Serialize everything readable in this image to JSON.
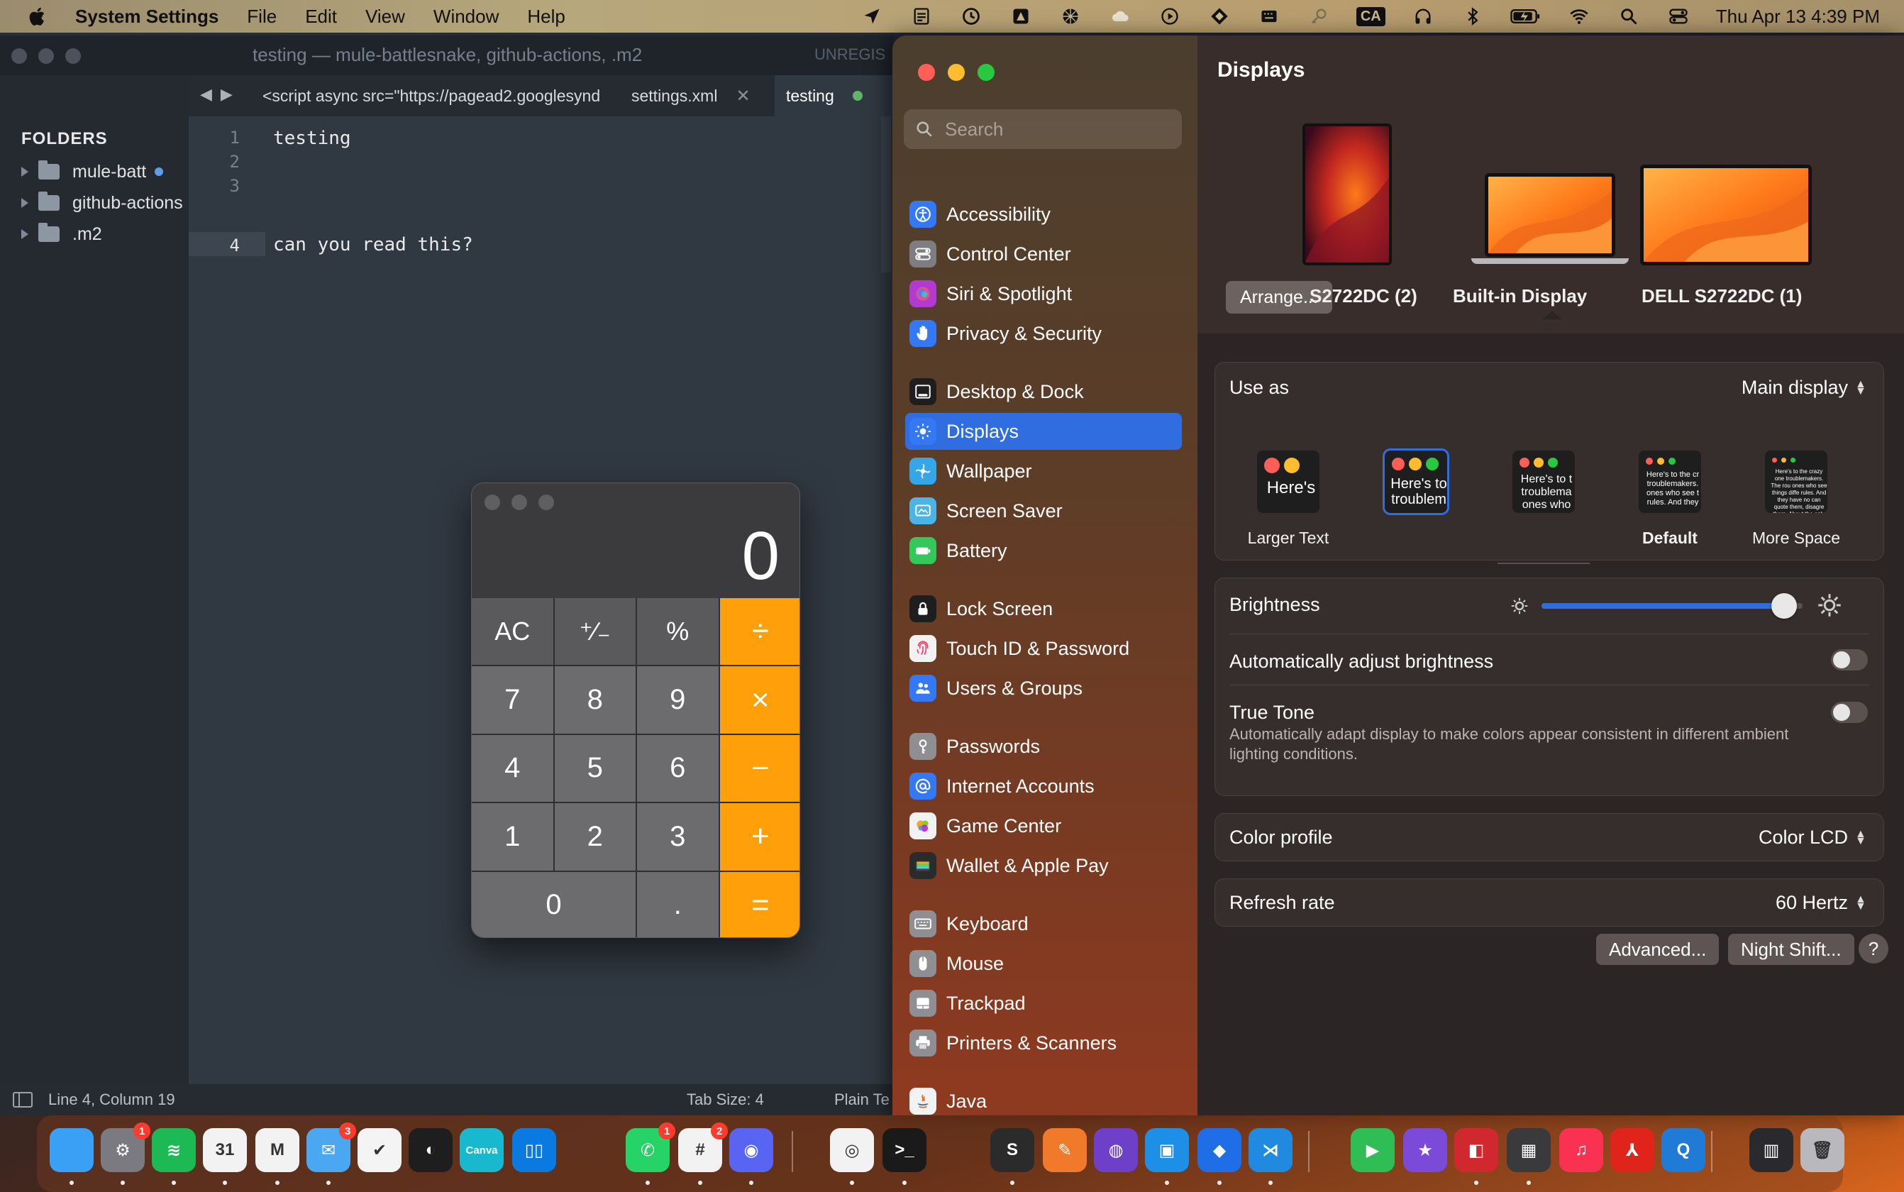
{
  "menubar": {
    "app_name": "System Settings",
    "menus": [
      "File",
      "Edit",
      "View",
      "Window",
      "Help"
    ],
    "input_source": "CA",
    "clock": "Thu Apr 13  4:39 PM"
  },
  "sublime": {
    "title": "testing — mule-battlesnake, github-actions, .m2",
    "unregistered": "UNREGIS",
    "sidebar_heading": "FOLDERS",
    "folders": [
      {
        "name": "mule-batt",
        "modified": true
      },
      {
        "name": "github-actions",
        "modified": false
      },
      {
        "name": ".m2",
        "modified": false
      }
    ],
    "tabs": [
      {
        "label": "<script async src=\"https://pagead2.googlesynd"
      },
      {
        "label": "settings.xml"
      },
      {
        "label": "testing"
      }
    ],
    "line_numbers": [
      "1",
      "2",
      "3",
      "4"
    ],
    "lines": [
      "testing",
      "",
      "",
      "can you read this?"
    ],
    "status": {
      "position": "Line 4, Column 19",
      "tab_size": "Tab Size: 4",
      "syntax": "Plain Te"
    }
  },
  "calculator": {
    "display": "0",
    "keys": [
      "AC",
      "⁺∕₋",
      "%",
      "÷",
      "7",
      "8",
      "9",
      "×",
      "4",
      "5",
      "6",
      "−",
      "1",
      "2",
      "3",
      "+",
      "0",
      ".",
      "="
    ]
  },
  "settings": {
    "search_placeholder": "Search",
    "sidebar": [
      {
        "label": "Accessibility",
        "icon": "accessibility-icon",
        "color": "#3478f6"
      },
      {
        "label": "Control Center",
        "icon": "control-center-icon",
        "color": "#7d7d82"
      },
      {
        "label": "Siri & Spotlight",
        "icon": "siri-icon",
        "color": "#b33ad1"
      },
      {
        "label": "Privacy & Security",
        "icon": "hand-icon",
        "color": "#3478f6"
      },
      {
        "label": "Desktop & Dock",
        "icon": "dock-icon",
        "color": "#1e1e1e"
      },
      {
        "label": "Displays",
        "icon": "sun-icon",
        "color": "#3478f6"
      },
      {
        "label": "Wallpaper",
        "icon": "wallpaper-icon",
        "color": "#35a6e8"
      },
      {
        "label": "Screen Saver",
        "icon": "screen-saver-icon",
        "color": "#4ab4e6"
      },
      {
        "label": "Battery",
        "icon": "battery-icon",
        "color": "#34c759"
      },
      {
        "label": "Lock Screen",
        "icon": "lock-icon",
        "color": "#1e1e1e"
      },
      {
        "label": "Touch ID & Password",
        "icon": "fingerprint-icon",
        "color": "#f2f2f2"
      },
      {
        "label": "Users & Groups",
        "icon": "users-icon",
        "color": "#3478f6"
      },
      {
        "label": "Passwords",
        "icon": "key-icon",
        "color": "#8e8e93"
      },
      {
        "label": "Internet Accounts",
        "icon": "at-icon",
        "color": "#3478f6"
      },
      {
        "label": "Game Center",
        "icon": "game-center-icon",
        "color": "#f2f2f2"
      },
      {
        "label": "Wallet & Apple Pay",
        "icon": "wallet-icon",
        "color": "#2b2b2b"
      },
      {
        "label": "Keyboard",
        "icon": "keyboard-icon",
        "color": "#8e8e93"
      },
      {
        "label": "Mouse",
        "icon": "mouse-icon",
        "color": "#8e8e93"
      },
      {
        "label": "Trackpad",
        "icon": "trackpad-icon",
        "color": "#8e8e93"
      },
      {
        "label": "Printers & Scanners",
        "icon": "printer-icon",
        "color": "#8e8e93"
      },
      {
        "label": "Java",
        "icon": "java-icon",
        "color": "#f2f2f2"
      }
    ],
    "page_title": "Displays",
    "arrange_button": "Arrange...",
    "displays": [
      {
        "name": "S2722DC (2)"
      },
      {
        "name": "Built-in Display",
        "selected": true
      },
      {
        "name": "DELL S2722DC (1)"
      }
    ],
    "use_as": {
      "label": "Use as",
      "value": "Main display"
    },
    "resolutions": [
      {
        "label": "Larger Text",
        "sample": "Here's"
      },
      {
        "label": "",
        "sample": "Here's to troublem",
        "selected": true
      },
      {
        "label": "",
        "sample": "Here's to t troublema ones who"
      },
      {
        "label": "Default",
        "sample": "Here's to the cr troublemakers. ones who see t rules. And they"
      },
      {
        "label": "More Space",
        "sample": "Here's to the crazy one troublemakers. The rou ones who see things diffe rules. And they have no can quote them, disagre them. About the only thi Because they change it"
      }
    ],
    "brightness": {
      "label": "Brightness",
      "level": 0.93
    },
    "auto_brightness": {
      "label": "Automatically adjust brightness",
      "on": false
    },
    "true_tone": {
      "label": "True Tone",
      "description": "Automatically adapt display to make colors appear consistent in different ambient lighting conditions.",
      "on": false
    },
    "color_profile": {
      "label": "Color profile",
      "value": "Color LCD"
    },
    "refresh_rate": {
      "label": "Refresh rate",
      "value": "60 Hertz"
    },
    "buttons": {
      "advanced": "Advanced...",
      "night_shift": "Night Shift...",
      "help": "?"
    }
  },
  "dock": {
    "apps": [
      {
        "name": "finder-icon",
        "label": "",
        "color": "#3aa0f5",
        "running": true
      },
      {
        "name": "system-settings-icon",
        "label": "⚙",
        "color": "#7a7a80",
        "badge": "1",
        "running": true
      },
      {
        "name": "spotify-icon",
        "label": "≋",
        "color": "#1db954",
        "running": true
      },
      {
        "name": "calendar-icon",
        "label": "31",
        "color": "#f2f2f2",
        "running": true
      },
      {
        "name": "gmail-icon",
        "label": "M",
        "color": "#f2f2f2",
        "running": true
      },
      {
        "name": "mail-icon",
        "label": "✉",
        "color": "#4aa7f0",
        "badge": "3",
        "running": true
      },
      {
        "name": "tasks-icon",
        "label": "✔",
        "color": "#f4f4f4",
        "running": false
      },
      {
        "name": "figma-icon",
        "label": "◐",
        "color": "#1e1e1e",
        "running": false
      },
      {
        "name": "canva-icon",
        "label": "Canva",
        "color": "#18b9cf",
        "running": false
      },
      {
        "name": "trello-icon",
        "label": "▯▯",
        "color": "#0a7ae0",
        "running": false
      },
      {
        "name": "whatsapp-icon",
        "label": "✆",
        "color": "#25d366",
        "badge": "1",
        "running": true
      },
      {
        "name": "slack-icon",
        "label": "#",
        "color": "#f2f2f2",
        "badge": "2",
        "running": true
      },
      {
        "name": "discord-icon",
        "label": "◉",
        "color": "#5865f2",
        "running": true
      },
      {
        "name": "chrome-icon",
        "label": "◎",
        "color": "#f2f2f2",
        "running": true
      },
      {
        "name": "terminal-icon",
        "label": ">_",
        "color": "#1a1a1a",
        "running": true
      },
      {
        "name": "sublime-icon",
        "label": "S",
        "color": "#2b2b2b",
        "running": true
      },
      {
        "name": "pen-icon",
        "label": "✎",
        "color": "#f07a2a",
        "running": false
      },
      {
        "name": "github-desktop-icon",
        "label": "◍",
        "color": "#6e40c9",
        "running": false
      },
      {
        "name": "docker-icon",
        "label": "▣",
        "color": "#1d8fe6",
        "running": true
      },
      {
        "name": "sourcetree-icon",
        "label": "◆",
        "color": "#1f6ee8",
        "running": true
      },
      {
        "name": "vscode-icon",
        "label": "⋊",
        "color": "#1f8ae0",
        "running": true
      },
      {
        "name": "facetime-icon",
        "label": "▶",
        "color": "#2fbe56",
        "running": false
      },
      {
        "name": "imovie-icon",
        "label": "★",
        "color": "#7b4ad8",
        "running": false
      },
      {
        "name": "photo-booth-icon",
        "label": "◧",
        "color": "#d1282f",
        "running": true
      },
      {
        "name": "calculator-icon",
        "label": "▦",
        "color": "#3a3a3c",
        "running": true
      },
      {
        "name": "music-icon",
        "label": "♫",
        "color": "#fa3150",
        "running": false
      },
      {
        "name": "acrobat-icon",
        "label": "⅄",
        "color": "#e0231b",
        "running": false
      },
      {
        "name": "quicktime-icon",
        "label": "Q",
        "color": "#1f7bd6",
        "running": false
      },
      {
        "name": "screenshot-icon",
        "label": "▥",
        "color": "#2a2a2e",
        "running": false
      },
      {
        "name": "trash-icon",
        "label": "🗑",
        "color": "#b9b9bd",
        "running": false
      }
    ]
  }
}
